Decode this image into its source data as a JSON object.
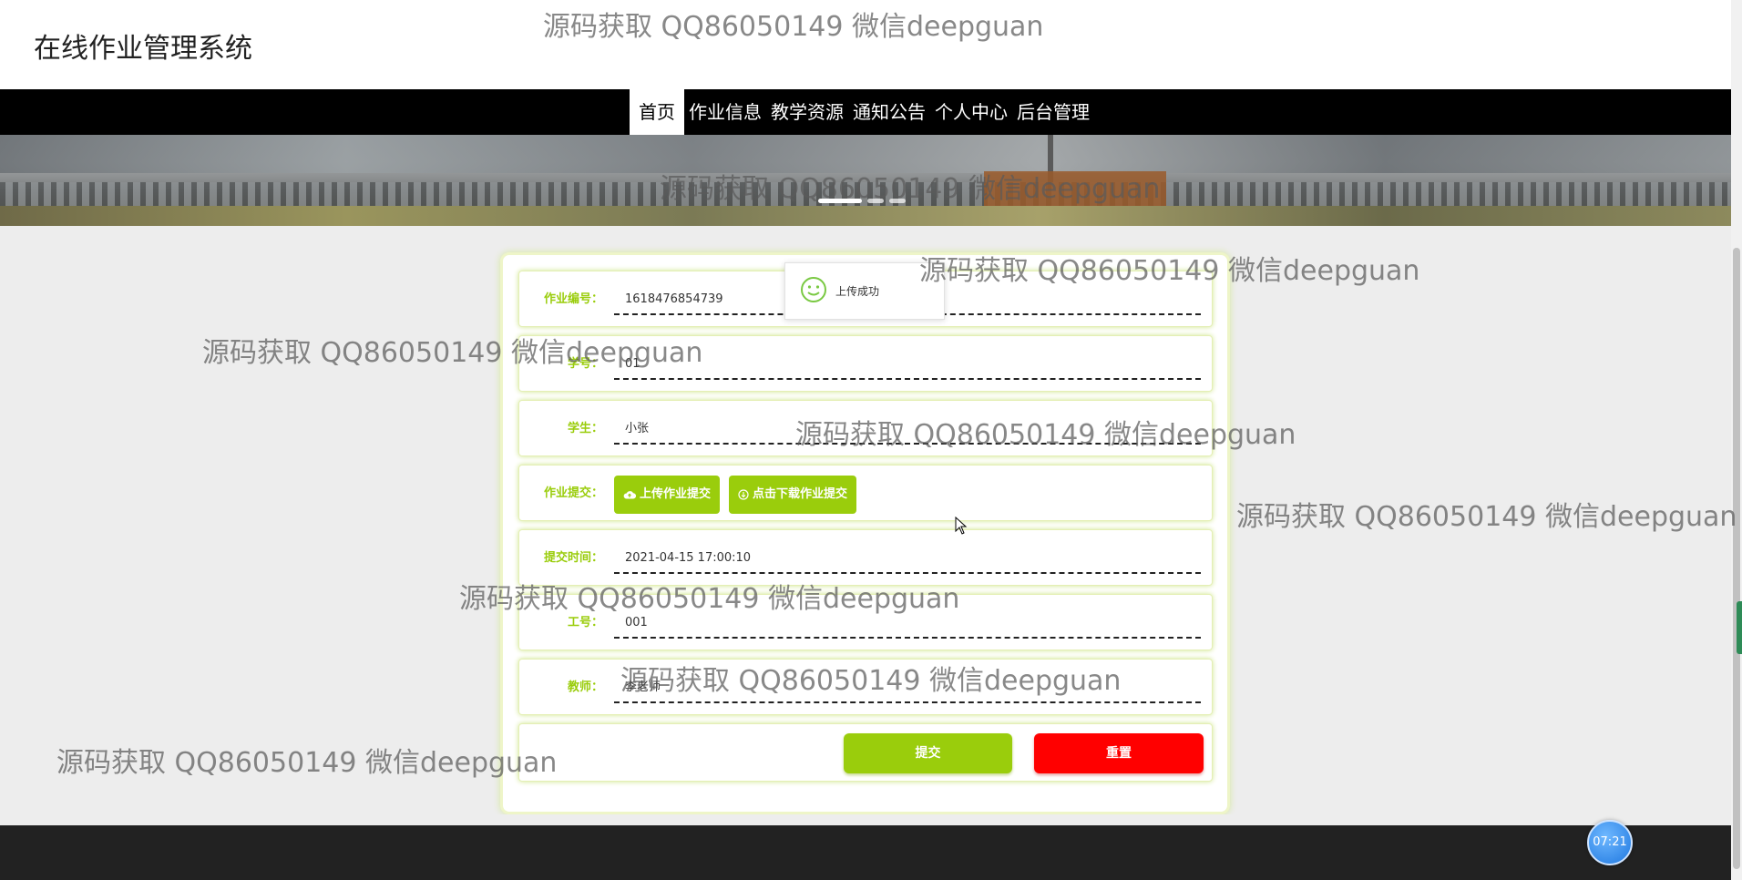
{
  "header": {
    "title": "在线作业管理系统"
  },
  "nav": {
    "items": [
      {
        "label": "首页",
        "active": true
      },
      {
        "label": "作业信息",
        "active": false
      },
      {
        "label": "教学资源",
        "active": false
      },
      {
        "label": "通知公告",
        "active": false
      },
      {
        "label": "个人中心",
        "active": false
      },
      {
        "label": "后台管理",
        "active": false
      }
    ]
  },
  "banner": {
    "slides": 3,
    "active_slide": 1
  },
  "form": {
    "fields": [
      {
        "label": "作业编号：",
        "value": "1618476854739"
      },
      {
        "label": "学号：",
        "value": "01"
      },
      {
        "label": "学生：",
        "value": "小张"
      },
      {
        "label": "作业提交：",
        "upload_label": "上传作业提交",
        "download_label": "点击下载作业提交"
      },
      {
        "label": "提交时间：",
        "value": "2021-04-15 17:00:10"
      },
      {
        "label": "工号：",
        "value": "001"
      },
      {
        "label": "教师：",
        "value": "李老师"
      }
    ],
    "submit_label": "提交",
    "reset_label": "重置"
  },
  "toast": {
    "text": "上传成功",
    "icon": "smile-icon"
  },
  "clock": {
    "time": "07:21"
  },
  "colors": {
    "accent": "#9acd0c",
    "danger": "#ff0000",
    "nav_bg": "#000000",
    "footer_bg": "#222222"
  },
  "watermark": {
    "text": "源码获取 QQ86050149 微信deepguan"
  }
}
